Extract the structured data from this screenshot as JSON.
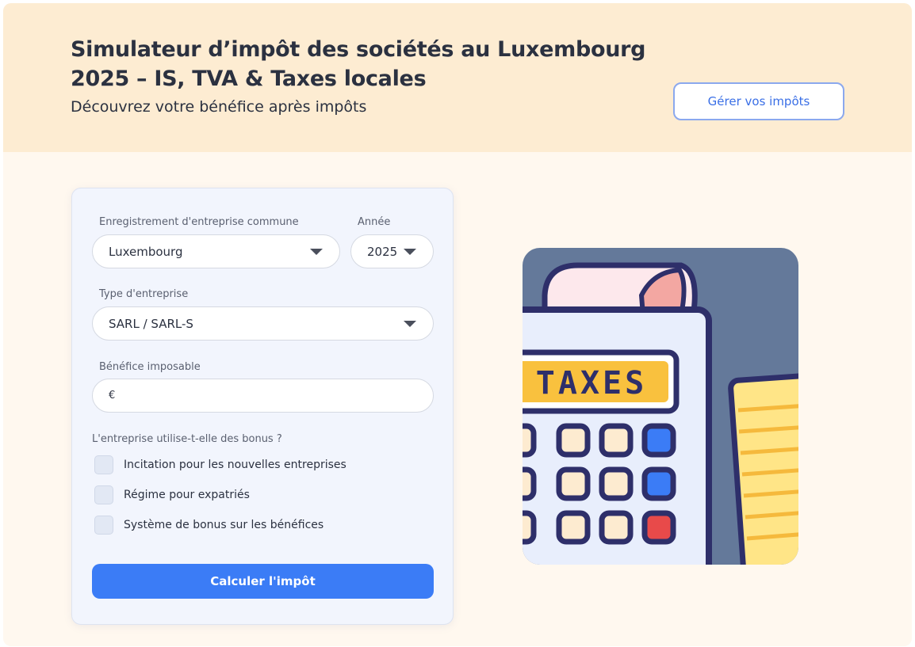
{
  "header": {
    "title": "Simulateur d’impôt des sociétés au Luxembourg 2025 – IS, TVA & Taxes locales",
    "subtitle": "Découvrez votre bénéfice après impôts",
    "manage_button": "Gérer vos impôts"
  },
  "form": {
    "commune_label": "Enregistrement d'entreprise commune",
    "commune_value": "Luxembourg",
    "year_label": "Année",
    "year_value": "2025",
    "company_type_label": "Type d'entreprise",
    "company_type_value": "SARL / SARL-S",
    "profit_label": "Bénéfice imposable",
    "currency_symbol": "€",
    "profit_value": "",
    "bonus_question": "L'entreprise utilise-t-elle des bonus ?",
    "bonus_options": [
      {
        "label": "Incitation pour les nouvelles entreprises",
        "checked": false
      },
      {
        "label": "Régime pour expatriés",
        "checked": false
      },
      {
        "label": "Système de bonus sur les bénéfices",
        "checked": false
      }
    ],
    "submit_button": "Calculer l'impôt"
  },
  "illustration": {
    "icon": "calculator-taxes-icon",
    "display_text": "TAXES"
  },
  "colors": {
    "header_bg": "#fdecd2",
    "page_bg": "#fff8ef",
    "card_bg": "#f2f5fd",
    "primary": "#3b7cf6",
    "outline_button": "#8ba8ee"
  }
}
